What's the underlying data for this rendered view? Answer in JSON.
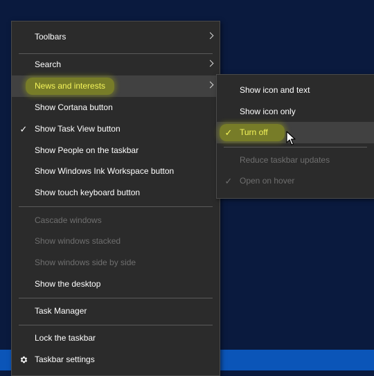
{
  "main_menu": {
    "toolbars": "Toolbars",
    "search": "Search",
    "news_and_interests": "News and interests",
    "show_cortana": "Show Cortana button",
    "show_task_view": "Show Task View button",
    "show_people": "Show People on the taskbar",
    "show_ink_workspace": "Show Windows Ink Workspace button",
    "show_touch_keyboard": "Show touch keyboard button",
    "cascade_windows": "Cascade windows",
    "show_windows_stacked": "Show windows stacked",
    "show_side_by_side": "Show windows side by side",
    "show_desktop": "Show the desktop",
    "task_manager": "Task Manager",
    "lock_taskbar": "Lock the taskbar",
    "taskbar_settings": "Taskbar settings"
  },
  "sub_menu": {
    "show_icon_and_text": "Show icon and text",
    "show_icon_only": "Show icon only",
    "turn_off": "Turn off",
    "reduce_updates": "Reduce taskbar updates",
    "open_on_hover": "Open on hover"
  },
  "glyphs": {
    "check": "✓"
  },
  "colors": {
    "menu_bg": "#2b2b2b",
    "highlight_yellow": "#f4f45a",
    "taskbar_blue": "#0b55b8",
    "desktop_bg": "#0a1a3e"
  }
}
